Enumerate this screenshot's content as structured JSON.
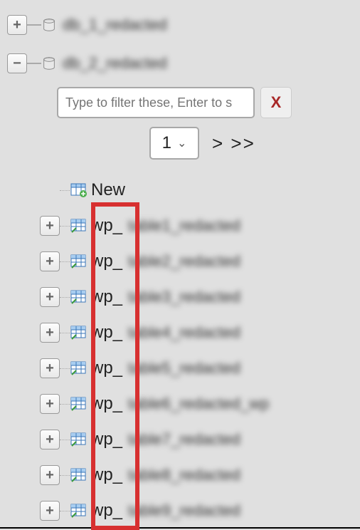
{
  "databases": [
    {
      "name": "db_1_redacted",
      "expanded": false
    },
    {
      "name": "db_2_redacted",
      "expanded": true
    }
  ],
  "filter": {
    "placeholder": "Type to filter these, Enter to s",
    "clear_label": "X"
  },
  "pager": {
    "page": "1",
    "next_label": "> >>"
  },
  "new_label": "New",
  "prefix_highlight": "wp_",
  "tables": [
    {
      "prefix": "wp_",
      "rest": "table1_redacted"
    },
    {
      "prefix": "wp_",
      "rest": "table2_redacted"
    },
    {
      "prefix": "wp_",
      "rest": "table3_redacted"
    },
    {
      "prefix": "wp_",
      "rest": "table4_redacted"
    },
    {
      "prefix": "wp_",
      "rest": "table5_redacted"
    },
    {
      "prefix": "wp_",
      "rest": "table6_redacted_wp"
    },
    {
      "prefix": "wp_",
      "rest": "table7_redacted"
    },
    {
      "prefix": "wp_",
      "rest": "table8_redacted"
    },
    {
      "prefix": "wp_",
      "rest": "table9_redacted"
    }
  ]
}
